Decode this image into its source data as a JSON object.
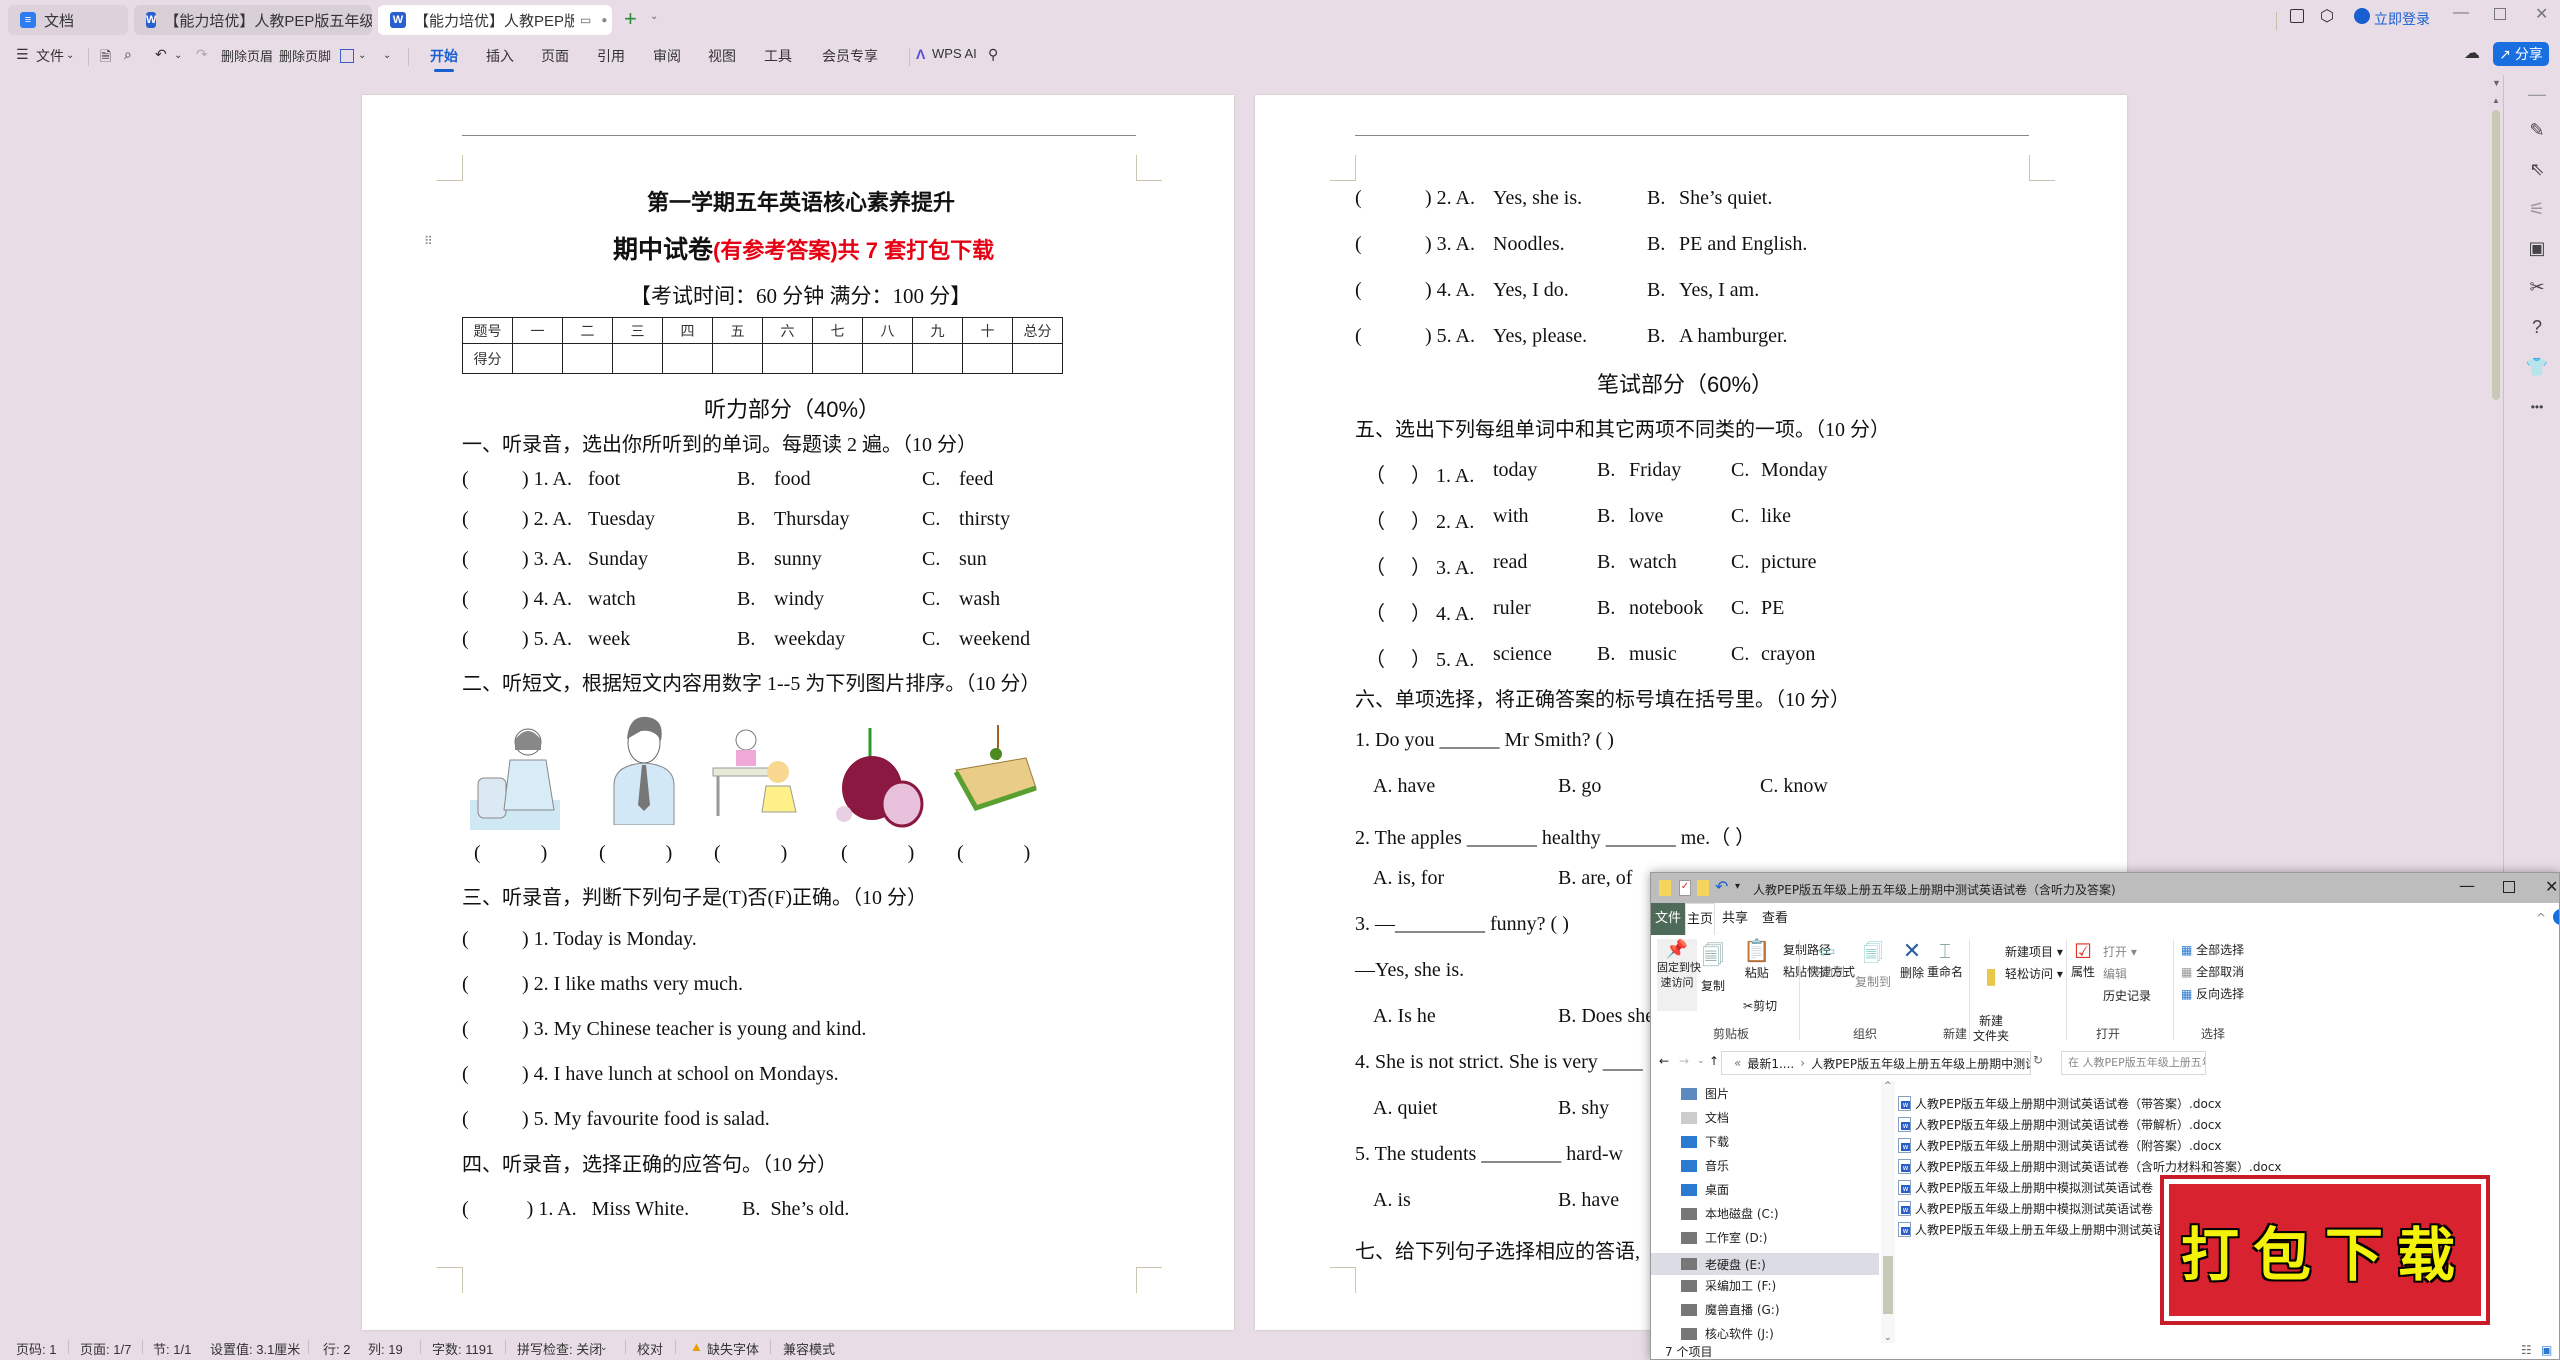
{
  "tabs": [
    {
      "label": "文档",
      "icon": "docs-icon"
    },
    {
      "label": "【能力培优】人教PEP版五年级上册英",
      "icon": "wps-writer-icon"
    },
    {
      "label": "【能力培优】人教PEP版五年级",
      "icon": "wps-writer-icon",
      "active": true
    }
  ],
  "titlebar": {
    "login_label": "立即登录",
    "share_label": "分享"
  },
  "menu": {
    "file": "文件",
    "delete_header": "删除页眉",
    "delete_footer": "删除页脚",
    "items": [
      "开始",
      "插入",
      "页面",
      "引用",
      "审阅",
      "视图",
      "工具",
      "会员专享"
    ],
    "active": "开始",
    "wps_ai": "WPS AI"
  },
  "page1": {
    "title1": "第一学期五年英语核心素养提升",
    "title2_black": "期中试卷",
    "title2_red": "(有参考答案)共 7 套打包下载",
    "exam_info": "【考试时间：60 分钟  满分：100 分】",
    "score_table": {
      "header": [
        "题号",
        "一",
        "二",
        "三",
        "四",
        "五",
        "六",
        "七",
        "八",
        "九",
        "十",
        "总分"
      ],
      "row_label": "得分"
    },
    "listening_heading": "听力部分（40%）",
    "sec1": {
      "title": "一、听录音，选出你所听到的单词。每题读 2 遍。（10 分）",
      "items": [
        {
          "num": ") 1. A.",
          "a": "foot",
          "b": "food",
          "c": "feed"
        },
        {
          "num": ") 2. A.",
          "a": "Tuesday",
          "b": "Thursday",
          "c": "thirsty"
        },
        {
          "num": ") 3. A.",
          "a": "Sunday",
          "b": "sunny",
          "c": "sun"
        },
        {
          "num": ") 4. A.",
          "a": "watch",
          "b": "windy",
          "c": "wash"
        },
        {
          "num": ") 5. A.",
          "a": "week",
          "b": "weekday",
          "c": "weekend"
        }
      ]
    },
    "sec2": {
      "title": "二、听短文，根据短文内容用数字 1--5 为下列图片排序。（10 分）",
      "pictures": [
        "scientist-picture",
        "man-picture",
        "kids-picture",
        "onion-picture",
        "sandwich-picture"
      ]
    },
    "sec3": {
      "title": "三、听录音，判断下列句子是(T)否(F)正确。（10 分）",
      "items": [
        ") 1. Today is Monday.",
        ") 2. I like maths very much.",
        ") 3. My Chinese teacher is young and kind.",
        ") 4. I have lunch at school on Mondays.",
        ") 5. My favourite food is salad."
      ]
    },
    "sec4": {
      "title": "四、听录音，选择正确的应答句。（10 分）",
      "item1": {
        "num": ") 1. A.",
        "a": "Miss White.",
        "b": "She’s old."
      }
    }
  },
  "page2": {
    "sec4_cont": [
      {
        "num": ") 2. A.",
        "a": "Yes, she is.",
        "b": "She’s quiet."
      },
      {
        "num": ") 3. A.",
        "a": "Noodles.",
        "b": "PE and English."
      },
      {
        "num": ") 4. A.",
        "a": "Yes, I do.",
        "b": "Yes, I am."
      },
      {
        "num": ") 5. A.",
        "a": "Yes, please.",
        "b": "A hamburger."
      }
    ],
    "writing_heading": "笔试部分（60%）",
    "sec5": {
      "title": "五、选出下列每组单词中和其它两项不同类的一项。（10 分）",
      "items": [
        {
          "num": "） 1. A.",
          "a": "today",
          "b": "Friday",
          "c": "Monday"
        },
        {
          "num": "） 2. A.",
          "a": "with",
          "b": "love",
          "c": "like"
        },
        {
          "num": "） 3. A.",
          "a": "read",
          "b": "watch",
          "c": "picture"
        },
        {
          "num": "） 4. A.",
          "a": "ruler",
          "b": "notebook",
          "c": "PE"
        },
        {
          "num": "） 5. A.",
          "a": "science",
          "b": "music",
          "c": "crayon"
        }
      ]
    },
    "sec6": {
      "title": "六、单项选择，将正确答案的标号填在括号里。（10 分）",
      "q1": "1.     Do you ______ Mr Smith? (      )",
      "q1_opts": [
        "A.  have",
        "B.   go",
        "C.   know"
      ],
      "q2": "2.     The apples _______ healthy _______ me.（        ）",
      "q2_opts": [
        "A.  is, for",
        "B.   are, of"
      ],
      "q3": "3.     —_________ funny?  (      )",
      "q3_ans": "—Yes, she is.",
      "q3_opts": [
        "A.  Is  he",
        "B.   Does she"
      ],
      "q4": "4.     She is not strict. She is very ____",
      "q4_opts": [
        "A.  quiet",
        "B.   shy"
      ],
      "q5": "5.     The students ________ hard-w",
      "q5_opts": [
        "A.  is",
        "B.   have"
      ]
    },
    "sec7_title": "七、给下列句子选择相应的答语,"
  },
  "statusbar": {
    "page_code": "页码: 1",
    "pages": "页面: 1/7",
    "section": "节: 1/1",
    "setting": "设置值: 3.1厘米",
    "row": "行: 2",
    "col": "列: 19",
    "words": "字数: 1191",
    "spell": "拼写检查: 关闭",
    "proof": "校对",
    "missing_font": "缺失字体",
    "compat": "兼容模式"
  },
  "explorer": {
    "title": "人教PEP版五年级上册五年级上册期中测试英语试卷（含听力及答案)",
    "tabs": [
      "文件",
      "主页",
      "共享",
      "查看"
    ],
    "ribbon": {
      "pin": "固定到快\n速访问",
      "copy": "复制",
      "paste": "粘贴",
      "copy_path": "复制路径",
      "paste_shortcut": "粘贴快捷方式",
      "cut": "剪切",
      "group_clipboard": "剪贴板",
      "move_to": "移动到",
      "copy_to": "复制到",
      "delete": "删除",
      "rename": "重命名",
      "group_organize": "组织",
      "new_folder": "新建\n文件夹",
      "new_item": "新建项目",
      "easy_access": "轻松访问",
      "group_new": "新建",
      "properties": "属性",
      "open": "打开",
      "edit": "编辑",
      "history": "历史记录",
      "group_open": "打开",
      "select_all": "全部选择",
      "select_none": "全部取消",
      "invert": "反向选择",
      "group_select": "选择"
    },
    "breadcrumb": [
      "最新1....",
      "人教PEP版五年级上册五年级上册期中测试英语试卷（含听力及答案)"
    ],
    "search_placeholder": "在 人教PEP版五年级上册五年级上...",
    "nav_items": [
      {
        "label": "图片",
        "icon": "pictures-icon"
      },
      {
        "label": "文档",
        "icon": "documents-icon"
      },
      {
        "label": "下载",
        "icon": "downloads-icon"
      },
      {
        "label": "音乐",
        "icon": "music-icon"
      },
      {
        "label": "桌面",
        "icon": "desktop-icon"
      },
      {
        "label": "本地磁盘 (C:)",
        "icon": "drive-icon"
      },
      {
        "label": "工作室 (D:)",
        "icon": "drive-icon"
      },
      {
        "label": "老硬盘 (E:)",
        "icon": "drive-icon",
        "selected": true
      },
      {
        "label": "采编加工 (F:)",
        "icon": "drive-icon"
      },
      {
        "label": "魔兽直播 (G:)",
        "icon": "drive-icon"
      },
      {
        "label": "核心软件 (J:)",
        "icon": "drive-icon"
      }
    ],
    "files": [
      "人教PEP版五年级上册期中测试英语试卷（带答案）.docx",
      "人教PEP版五年级上册期中测试英语试卷（带解析）.docx",
      "人教PEP版五年级上册期中测试英语试卷（附答案）.docx",
      "人教PEP版五年级上册期中测试英语试卷（含听力材料和答案）.docx",
      "人教PEP版五年级上册期中模拟测试英语试卷（含听力及答案）.docx",
      "人教PEP版五年级上册期中模拟测试英语试卷",
      "人教PEP版五年级上册五年级上册期中测试英语"
    ],
    "item_count": "7 个项目"
  },
  "stamp": {
    "label": "打包下载",
    "color": "#d8222f",
    "text_color": "#f5f20a"
  },
  "colors": {
    "accent": "#1a5fd0",
    "title_red": "#e60012",
    "background": "#e8dde6"
  }
}
